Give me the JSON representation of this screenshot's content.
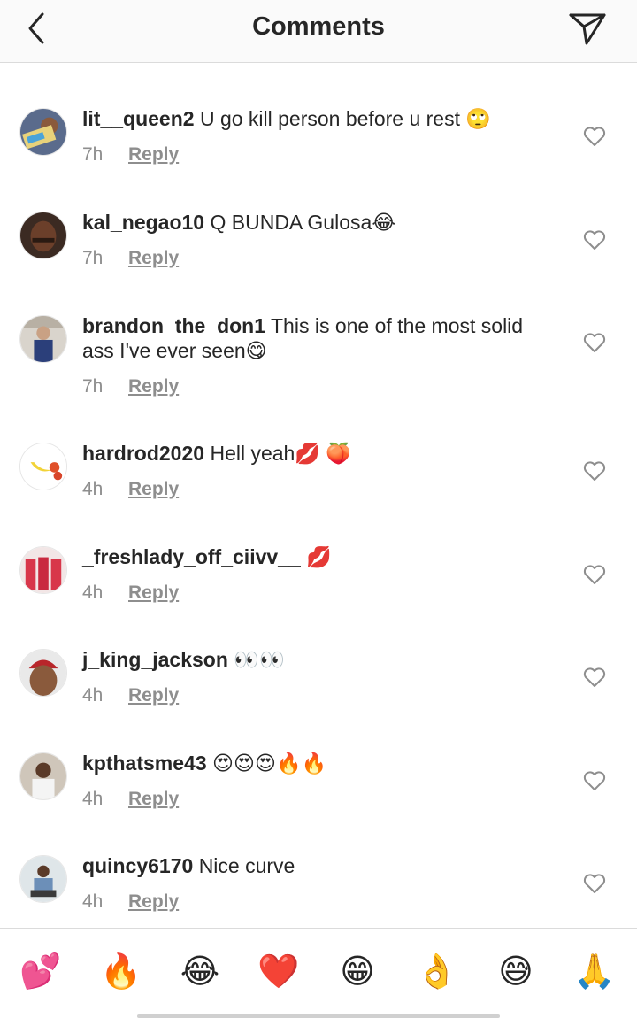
{
  "header": {
    "title": "Comments"
  },
  "comments": [
    {
      "username": "lit__queen2",
      "text": "U go kill person before u rest 🙄",
      "time": "7h",
      "reply": "Reply"
    },
    {
      "username": "kal_negao10",
      "text": "Q BUNDA Gulosa😂",
      "time": "7h",
      "reply": "Reply"
    },
    {
      "username": "brandon_the_don1",
      "text": "This is one of the most solid ass I've ever seen😋",
      "time": "7h",
      "reply": "Reply"
    },
    {
      "username": "hardrod2020",
      "text": "Hell yeah💋 🍑",
      "time": "4h",
      "reply": "Reply"
    },
    {
      "username": "_freshlady_off_ciivv__",
      "text": "💋",
      "time": "4h",
      "reply": "Reply"
    },
    {
      "username": "j_king_jackson",
      "text": "👀👀",
      "time": "4h",
      "reply": "Reply"
    },
    {
      "username": "kpthatsme43",
      "text": "😍😍😍🔥🔥",
      "time": "4h",
      "reply": "Reply"
    },
    {
      "username": "quincy6170",
      "text": "Nice curve",
      "time": "4h",
      "reply": "Reply"
    }
  ],
  "emoji_bar": [
    "💕",
    "🔥",
    "😂",
    "❤️",
    "😁",
    "👌",
    "😅",
    "🙏"
  ],
  "colors": {
    "text": "#262626",
    "secondary": "#8e8e8e",
    "divider": "#dbdbdb",
    "header_bg": "#fafafa"
  }
}
